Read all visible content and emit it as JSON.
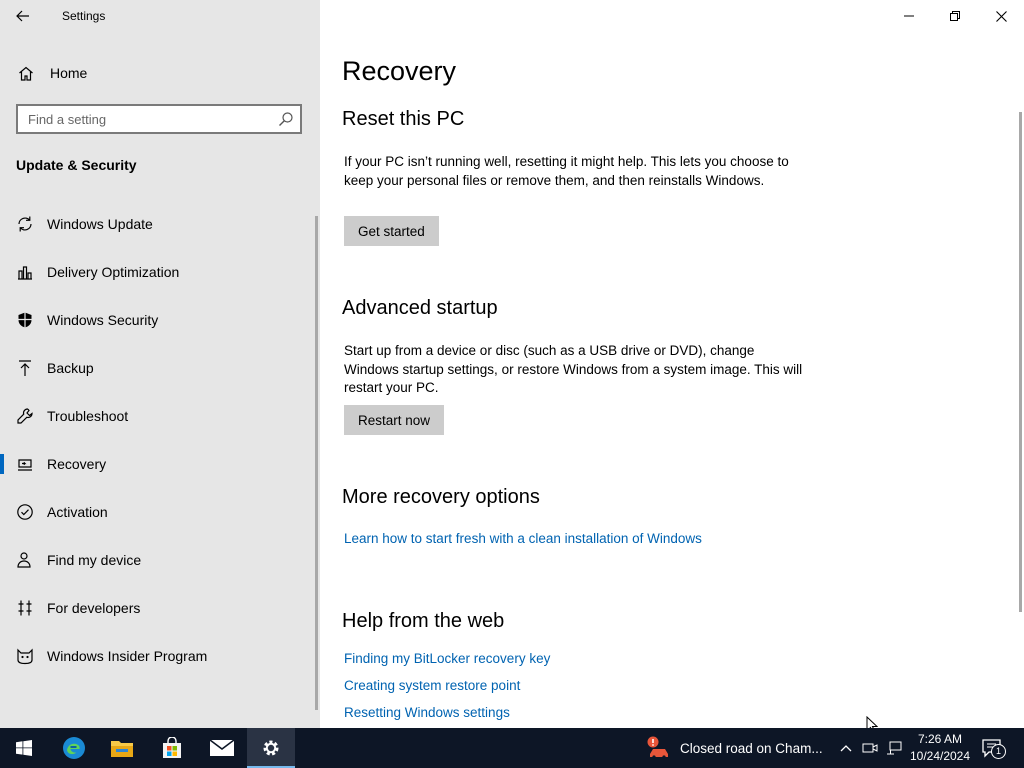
{
  "window": {
    "title": "Settings",
    "controls": {
      "minimize": "—",
      "restore": "❐",
      "close": "✕"
    }
  },
  "sidebar": {
    "home_label": "Home",
    "search_placeholder": "Find a setting",
    "section": "Update & Security",
    "items": [
      {
        "label": "Windows Update",
        "icon": "refresh-icon"
      },
      {
        "label": "Delivery Optimization",
        "icon": "delivery-optimization-icon"
      },
      {
        "label": "Windows Security",
        "icon": "shield-icon"
      },
      {
        "label": "Backup",
        "icon": "backup-icon"
      },
      {
        "label": "Troubleshoot",
        "icon": "wrench-icon"
      },
      {
        "label": "Recovery",
        "icon": "recovery-icon",
        "active": true
      },
      {
        "label": "Activation",
        "icon": "check-circle-icon"
      },
      {
        "label": "Find my device",
        "icon": "person-location-icon"
      },
      {
        "label": "For developers",
        "icon": "developer-icon"
      },
      {
        "label": "Windows Insider Program",
        "icon": "insider-cat-icon"
      }
    ]
  },
  "main": {
    "title": "Recovery",
    "reset": {
      "heading": "Reset this PC",
      "description": "If your PC isn’t running well, resetting it might help. This lets you choose to keep your personal files or remove them, and then reinstalls Windows.",
      "button": "Get started"
    },
    "advanced": {
      "heading": "Advanced startup",
      "description": "Start up from a device or disc (such as a USB drive or DVD), change Windows startup settings, or restore Windows from a system image. This will restart your PC.",
      "button": "Restart now"
    },
    "more": {
      "heading": "More recovery options",
      "link": "Learn how to start fresh with a clean installation of Windows"
    },
    "help": {
      "heading": "Help from the web",
      "links": [
        "Finding my BitLocker recovery key",
        "Creating system restore point",
        "Resetting Windows settings"
      ]
    }
  },
  "taskbar": {
    "apps": [
      "start-icon",
      "edge-icon",
      "file-explorer-icon",
      "store-icon",
      "mail-icon",
      "settings-icon"
    ],
    "news": "Closed road on Cham...",
    "time": "7:26 AM",
    "date": "10/24/2024",
    "notification_count": "1"
  },
  "colors": {
    "accent": "#0067c0",
    "link": "#0063b1",
    "taskbar": "#0d1626",
    "sidebar": "#e6e6e6"
  }
}
